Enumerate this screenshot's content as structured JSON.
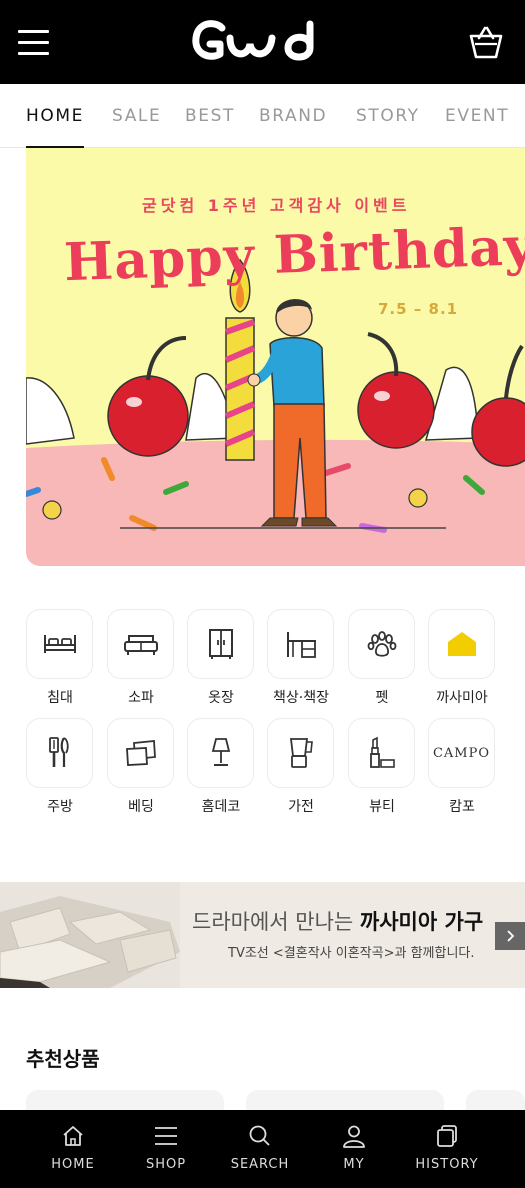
{
  "header": {
    "logo_text": "Good",
    "menu_icon": "hamburger-icon",
    "cart_icon": "shopping-bag-icon"
  },
  "nav": {
    "tabs": [
      {
        "label": "HOME",
        "active": true
      },
      {
        "label": "SALE",
        "active": false
      },
      {
        "label": "BEST",
        "active": false
      },
      {
        "label": "BRAND",
        "active": false
      },
      {
        "label": "STORY",
        "active": false
      },
      {
        "label": "EVENT",
        "active": false
      }
    ]
  },
  "hero": {
    "subtitle": "굳닷컴 1주년 고객감사 이벤트",
    "title": "Happy Birthday",
    "date": "7.5 – 8.1",
    "colors": {
      "background": "#fbfaa8",
      "floor": "#f8b8b8",
      "title": "#ec3d5a"
    }
  },
  "categories": [
    {
      "label": "침대",
      "icon": "bed-icon"
    },
    {
      "label": "소파",
      "icon": "sofa-icon"
    },
    {
      "label": "옷장",
      "icon": "wardrobe-icon"
    },
    {
      "label": "책상·책장",
      "icon": "desk-icon"
    },
    {
      "label": "펫",
      "icon": "paw-icon"
    },
    {
      "label": "까사미아",
      "icon": "casamia-house-icon"
    },
    {
      "label": "주방",
      "icon": "kitchen-utensils-icon"
    },
    {
      "label": "베딩",
      "icon": "pillow-icon"
    },
    {
      "label": "홈데코",
      "icon": "lamp-icon"
    },
    {
      "label": "가전",
      "icon": "blender-icon"
    },
    {
      "label": "뷰티",
      "icon": "lipstick-icon"
    },
    {
      "label": "캄포",
      "icon": "campo-logo-icon",
      "logo_text": "CAMPO"
    }
  ],
  "promo": {
    "main_prefix": "드라마에서 만나는 ",
    "main_bold": "까사미아 가구",
    "sub": "TV조선 <결혼작사 이혼작곡>과 함께합니다."
  },
  "recommended": {
    "title": "추천상품"
  },
  "bottom_nav": [
    {
      "label": "HOME",
      "icon": "home-icon"
    },
    {
      "label": "SHOP",
      "icon": "menu-icon"
    },
    {
      "label": "SEARCH",
      "icon": "search-icon"
    },
    {
      "label": "MY",
      "icon": "user-icon"
    },
    {
      "label": "HISTORY",
      "icon": "history-icon"
    }
  ]
}
